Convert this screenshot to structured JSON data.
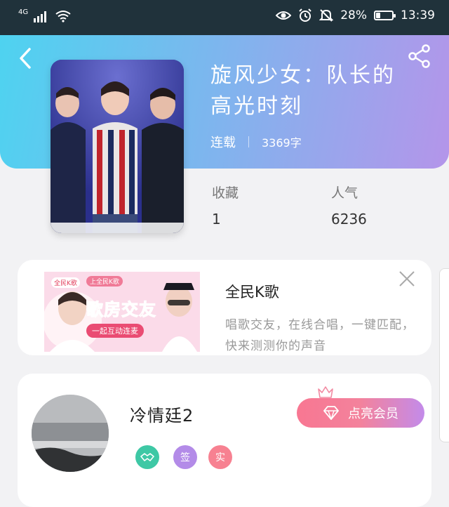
{
  "status_bar": {
    "network": "4G",
    "battery_text": "28%",
    "battery_level": 0.28,
    "time": "13:39"
  },
  "book": {
    "title_line1": "旋风少女：队长的",
    "title_line2": "高光时刻",
    "status": "连载",
    "word_count": "3369字"
  },
  "stats": {
    "favorites_label": "收藏",
    "favorites_value": "1",
    "popularity_label": "人气",
    "popularity_value": "6236"
  },
  "ad": {
    "image_brand": "全民K歌",
    "image_tag": "上全民K歌",
    "image_headline": "歌房交友",
    "image_subline": "一起互动连麦",
    "title": "全民K歌",
    "description": "唱歌交友，在线合唱，一键匹配，快来测测你的声音"
  },
  "profile": {
    "username": "冷情廷2",
    "vip_button": "点亮会员",
    "badges": [
      {
        "label": "",
        "color": "#3ec8a5"
      },
      {
        "label": "签",
        "color": "#b38be8"
      },
      {
        "label": "实",
        "color": "#f78191"
      }
    ]
  },
  "colors": {
    "hero_start": "#4ed3f0",
    "hero_end": "#b495ea",
    "vip_start": "#f87792",
    "vip_end": "#c38bea"
  },
  "icons": {
    "back": "back-arrow-icon",
    "share": "share-icon",
    "close": "close-icon",
    "eye": "eye-icon",
    "alarm": "alarm-icon",
    "mute": "mute-bell-icon",
    "wifi": "wifi-icon",
    "signal": "signal-icon",
    "crown": "crown-icon",
    "diamond": "diamond-icon",
    "handshake": "handshake-icon"
  }
}
